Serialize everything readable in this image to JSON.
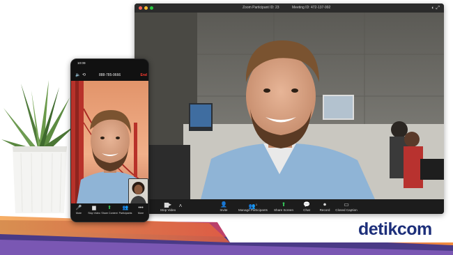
{
  "desktop": {
    "title": "Zoom Participant ID: 23",
    "meeting_id": "Meeting ID: 472-137-992",
    "toolbar": [
      {
        "label": "Stop Video",
        "icon": "video-camera-icon"
      },
      {
        "label": "Invite",
        "icon": "invite-icon"
      },
      {
        "label": "Manage Participants",
        "icon": "participants-icon",
        "count": "1"
      },
      {
        "label": "Share Screen",
        "icon": "share-screen-icon"
      },
      {
        "label": "Chat",
        "icon": "chat-icon"
      },
      {
        "label": "Record",
        "icon": "record-icon"
      },
      {
        "label": "Closed Caption",
        "icon": "closed-caption-icon"
      }
    ]
  },
  "phone": {
    "time": "10:09",
    "meeting_id": "888-785-9666",
    "end_label": "End",
    "toolbar": [
      {
        "label": "Mute",
        "icon": "microphone-icon"
      },
      {
        "label": "Stop Video",
        "icon": "video-camera-icon"
      },
      {
        "label": "Share Content",
        "icon": "share-content-icon"
      },
      {
        "label": "Participants",
        "icon": "participants-icon"
      },
      {
        "label": "More",
        "icon": "more-icon"
      }
    ]
  },
  "brand": {
    "logo_text_1": "detik",
    "logo_text_2": "com"
  },
  "colors": {
    "zoom_green": "#35c759",
    "end_red": "#ff3b30",
    "logo_blue": "#1d2f7a",
    "band_orange": "#f08a3c",
    "band_purple": "#5c3d8f"
  }
}
